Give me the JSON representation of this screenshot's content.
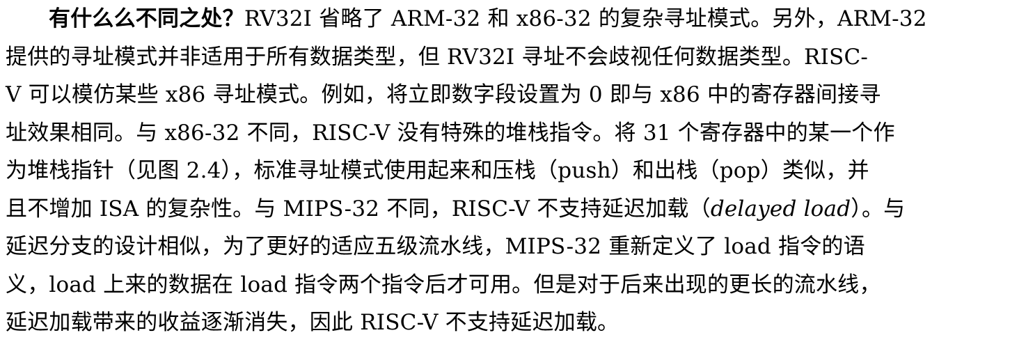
{
  "paragraph": {
    "lines": [
      {
        "lead_bold": "有什么么不同之处？",
        "text": "RV32I 省略了 ARM-32 和 x86-32 的复杂寻址模式。另外，ARM-32"
      },
      {
        "text": "提供的寻址模式并非适用于所有数据类型，但 RV32I  寻址不会歧视任何数据类型。RISC-"
      },
      {
        "text": "V 可以模仿某些 x86 寻址模式。例如，将立即数字段设置为 0 即与 x86 中的寄存器间接寻"
      },
      {
        "text": "址效果相同。与 x86-32 不同，RISC-V 没有特殊的堆栈指令。将 31 个寄存器中的某一个作"
      },
      {
        "text": "为堆栈指针（见图 2.4），标准寻址模式使用起来和压栈（push）和出栈（pop）类似，并"
      },
      {
        "text_before": "且不增加 ISA 的复杂性。与 MIPS-32 不同，RISC-V 不支持延迟加载（",
        "italic": "delayed load",
        "text_after": "）。与"
      },
      {
        "text": "延迟分支的设计相似，为了更好的适应五级流水线，MIPS-32 重新定义了 load 指令的语"
      },
      {
        "text": "义，load 上来的数据在 load 指令两个指令后才可用。但是对于后来出现的更长的流水线，"
      },
      {
        "text": "延迟加载带来的收益逐渐消失，因此 RISC-V 不支持延迟加载。"
      }
    ]
  }
}
